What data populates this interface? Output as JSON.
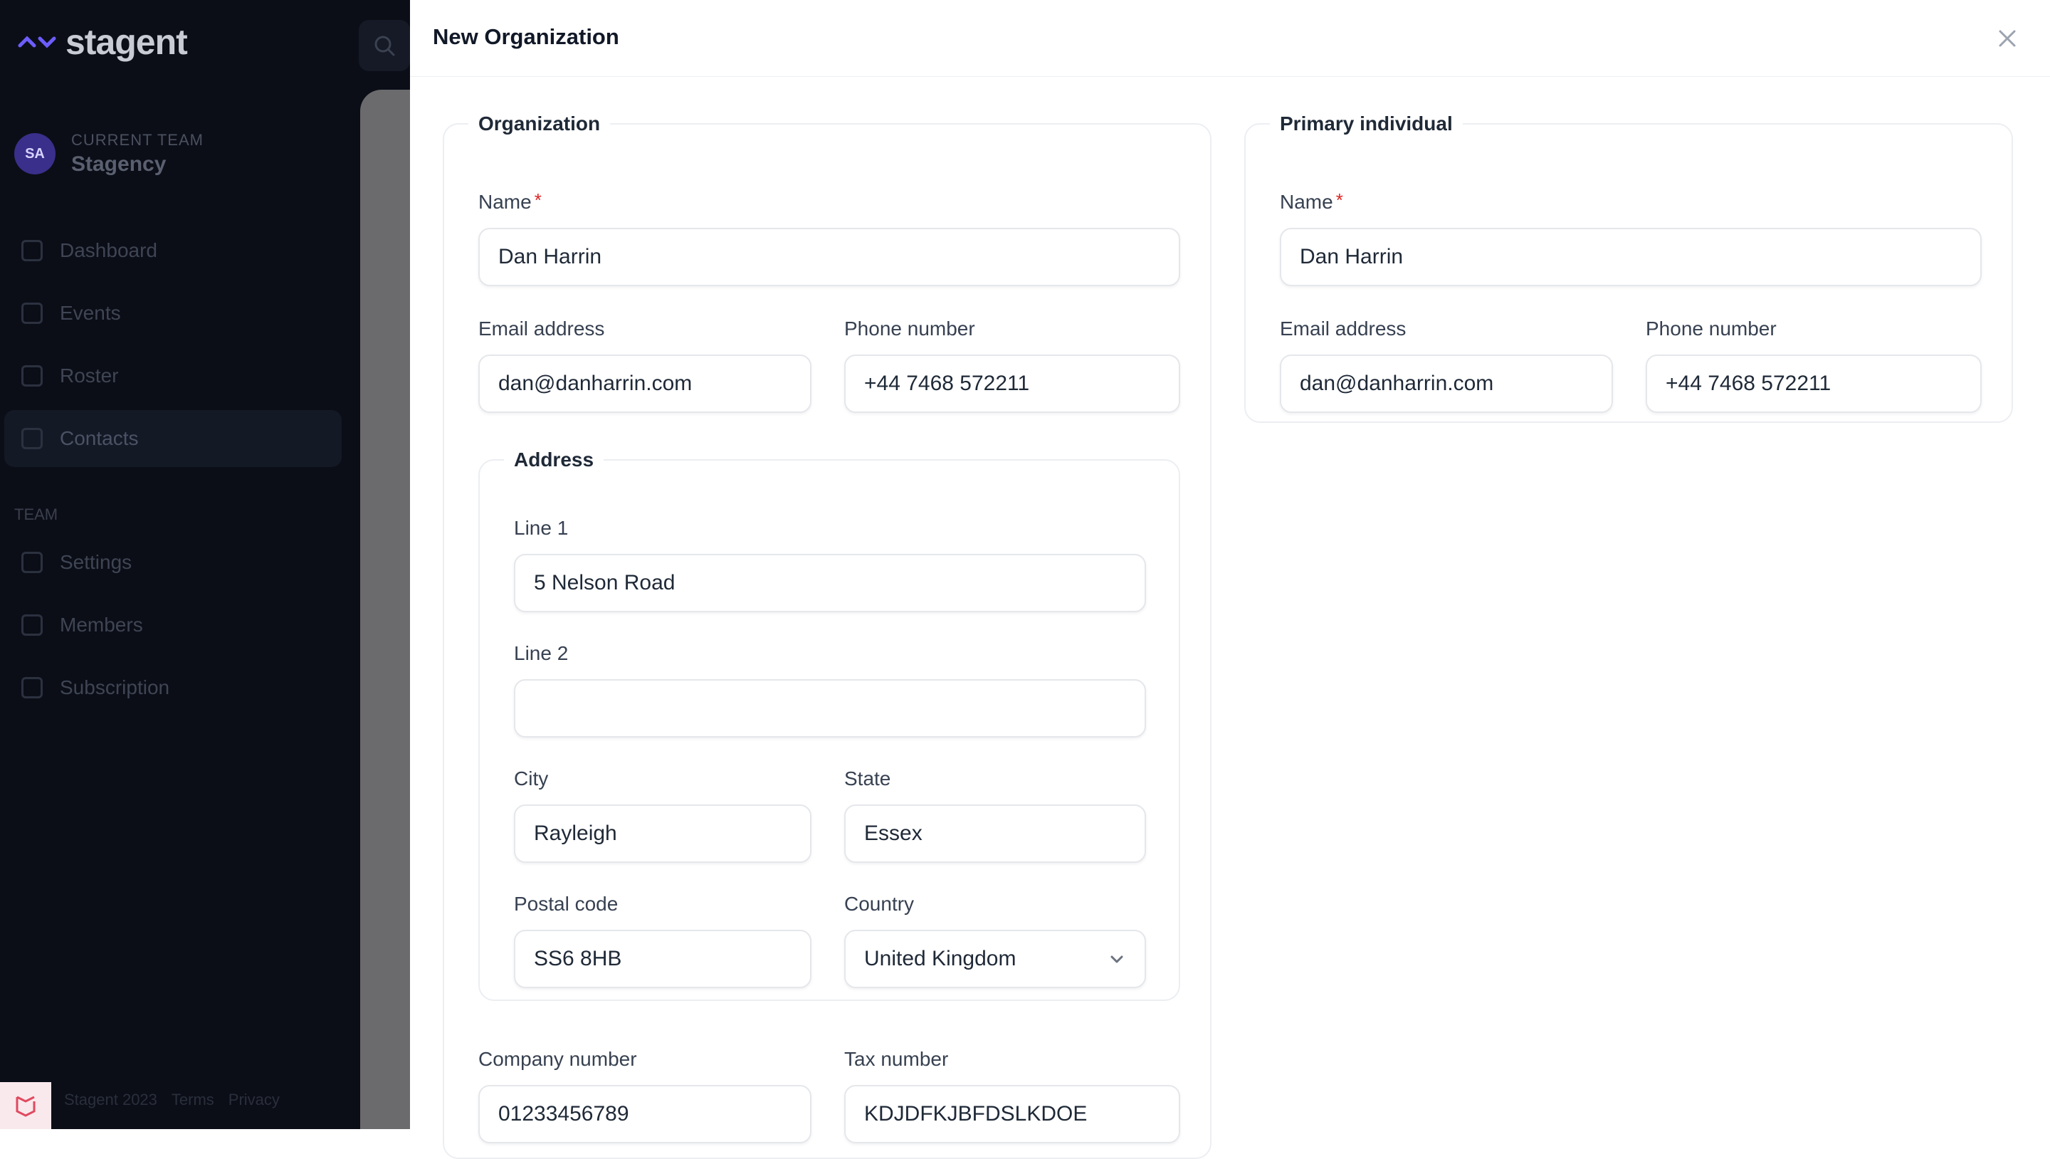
{
  "app": {
    "logo_text": "stagent",
    "team": {
      "avatar_initials": "SA",
      "caption": "CURRENT TEAM",
      "name": "Stagency"
    },
    "nav": [
      {
        "label": "Dashboard",
        "icon": "home-icon"
      },
      {
        "label": "Events",
        "icon": "calendar-icon"
      },
      {
        "label": "Roster",
        "icon": "list-icon"
      },
      {
        "label": "Contacts",
        "icon": "user-icon",
        "active": true
      }
    ],
    "nav_heading": "TEAM",
    "nav_team": [
      {
        "label": "Settings",
        "icon": "gear-icon"
      },
      {
        "label": "Members",
        "icon": "users-icon"
      },
      {
        "label": "Subscription",
        "icon": "card-icon"
      }
    ],
    "footer": {
      "copyright": "Stagent 2023",
      "terms": "Terms",
      "privacy": "Privacy"
    }
  },
  "modal": {
    "title": "New Organization",
    "organization": {
      "legend": "Organization",
      "name_label": "Name",
      "name_value": "Dan Harrin",
      "email_label": "Email address",
      "email_value": "dan@danharrin.com",
      "phone_label": "Phone number",
      "phone_value": "+44 7468 572211",
      "address": {
        "legend": "Address",
        "line1_label": "Line 1",
        "line1_value": "5 Nelson Road",
        "line2_label": "Line 2",
        "line2_value": "",
        "city_label": "City",
        "city_value": "Rayleigh",
        "state_label": "State",
        "state_value": "Essex",
        "postal_label": "Postal code",
        "postal_value": "SS6 8HB",
        "country_label": "Country",
        "country_value": "United Kingdom"
      },
      "company_number_label": "Company number",
      "company_number_value": "01233456789",
      "tax_number_label": "Tax number",
      "tax_number_value": "KDJDFKJBFDSLKDOE"
    },
    "primary_individual": {
      "legend": "Primary individual",
      "name_label": "Name",
      "name_value": "Dan Harrin",
      "email_label": "Email address",
      "email_value": "dan@danharrin.com",
      "phone_label": "Phone number",
      "phone_value": "+44 7468 572211"
    },
    "required_marker": "*"
  },
  "colors": {
    "accent": "#6d5dfc",
    "required": "#dc2626",
    "sidebar_bg": "#0b0e17"
  }
}
